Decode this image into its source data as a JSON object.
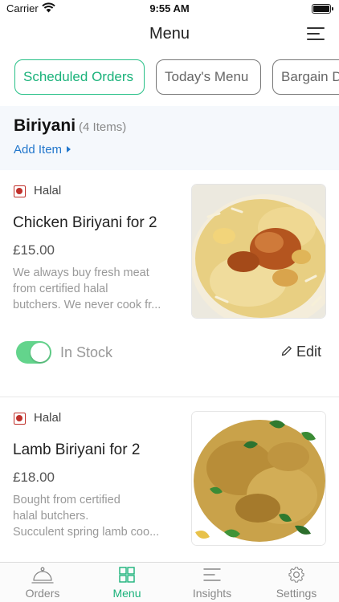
{
  "status_bar": {
    "carrier": "Carrier",
    "time": "9:55 AM"
  },
  "header": {
    "title": "Menu",
    "menu_icon": "hamburger-menu-icon"
  },
  "tabs": [
    {
      "label": "Scheduled Orders",
      "active": true
    },
    {
      "label": "Today's Menu",
      "active": false
    },
    {
      "label": "Bargain Deals",
      "active": false
    }
  ],
  "category": {
    "title": "Biriyani",
    "count": "(4 Items)",
    "add_label": "Add Item"
  },
  "items": [
    {
      "badge": "Halal",
      "name": "Chicken Biriyani for 2",
      "price": "£15.00",
      "description": "We always buy fresh meat\nfrom certified halal\nbutchers. We never cook fr...",
      "stock_label": "In Stock",
      "in_stock": true,
      "edit_label": "Edit"
    },
    {
      "badge": "Halal",
      "name": "Lamb Biriyani for 2",
      "price": "£18.00",
      "description": "Bought from certified\nhalal butchers.\nSucculent spring lamb coo..."
    }
  ],
  "tab_bar": [
    {
      "label": "Orders",
      "icon": "cloche-icon",
      "active": false
    },
    {
      "label": "Menu",
      "icon": "grid-icon",
      "active": true
    },
    {
      "label": "Insights",
      "icon": "lines-icon",
      "active": false
    },
    {
      "label": "Settings",
      "icon": "gear-icon",
      "active": false
    }
  ],
  "colors": {
    "accent": "#1ab27a",
    "link": "#2277cc",
    "halal": "#c0302b",
    "toggle_on": "#63d48c"
  }
}
